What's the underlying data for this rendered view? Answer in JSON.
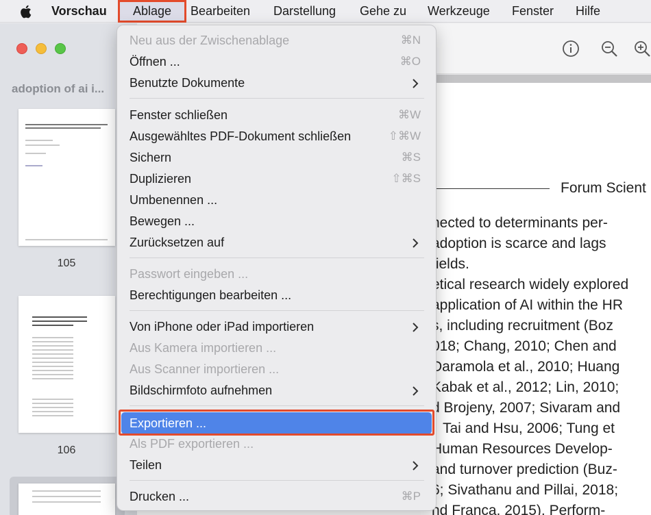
{
  "menubar": {
    "app_name": "Vorschau",
    "items": [
      "Ablage",
      "Bearbeiten",
      "Darstellung",
      "Gehe zu",
      "Werkzeuge",
      "Fenster",
      "Hilfe"
    ]
  },
  "sidebar": {
    "doc_title": "adoption of ai i...",
    "pages": [
      "105",
      "106"
    ]
  },
  "page_text": {
    "header": "Forum Scient",
    "lines": [
      "nected to determinants per-",
      "adoption is scarce and lags",
      "fields.",
      "etical research widely explored",
      "application of AI within the HR",
      "s, including recruitment (Boz",
      "018; Chang, 2010; Chen and",
      "Daramola et al., 2010; Huang",
      "Kabak et al., 2012; Lin, 2010;",
      "d Brojeny, 2007; Sivaram and",
      "Tai and Hsu, 2006; Tung et",
      "Human Resources Develop-",
      "and turnover prediction (Buz-",
      "6; Sivathanu and Pillai, 2018;",
      "nd Franca, 2015), Perform-"
    ]
  },
  "menu": {
    "items": [
      {
        "label": "Neu aus der Zwischenablage",
        "shortcut": "⌘N",
        "disabled": true
      },
      {
        "label": "Öffnen ...",
        "shortcut": "⌘O"
      },
      {
        "label": "Benutzte Dokumente",
        "submenu": true
      },
      {
        "label": "Fenster schließen",
        "shortcut": "⌘W"
      },
      {
        "label": "Ausgewähltes PDF-Dokument schließen",
        "shortcut": "⇧⌘W"
      },
      {
        "label": "Sichern",
        "shortcut": "⌘S"
      },
      {
        "label": "Duplizieren",
        "shortcut": "⇧⌘S"
      },
      {
        "label": "Umbenennen ..."
      },
      {
        "label": "Bewegen ..."
      },
      {
        "label": "Zurücksetzen auf",
        "submenu": true
      },
      {
        "label": "Passwort eingeben ...",
        "disabled": true
      },
      {
        "label": "Berechtigungen bearbeiten ..."
      },
      {
        "label": "Von iPhone oder iPad importieren",
        "submenu": true
      },
      {
        "label": "Aus Kamera importieren ...",
        "disabled": true
      },
      {
        "label": "Aus Scanner importieren ...",
        "disabled": true
      },
      {
        "label": "Bildschirmfoto aufnehmen",
        "submenu": true
      },
      {
        "label": "Exportieren ...",
        "highlighted": true
      },
      {
        "label": "Als PDF exportieren ...",
        "disabled": true
      },
      {
        "label": "Teilen",
        "submenu": true
      },
      {
        "label": "Drucken ...",
        "shortcut": "⌘P"
      }
    ]
  },
  "colors": {
    "highlight": "#4f84e8",
    "annotation": "#e34b2c"
  }
}
